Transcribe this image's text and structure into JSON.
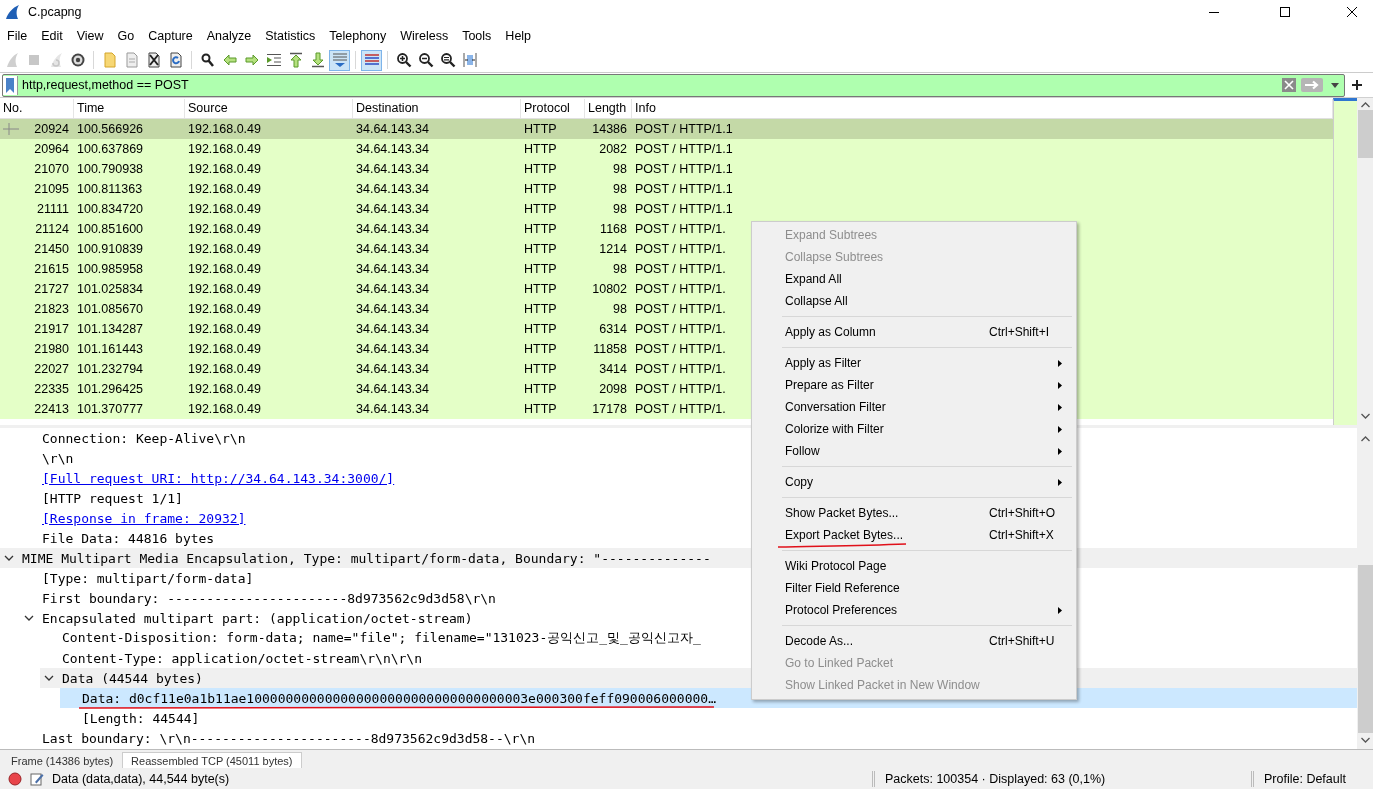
{
  "window": {
    "title": "C.pcapng"
  },
  "menu_bar": [
    "File",
    "Edit",
    "View",
    "Go",
    "Capture",
    "Analyze",
    "Statistics",
    "Telephony",
    "Wireless",
    "Tools",
    "Help"
  ],
  "toolbar": [
    {
      "kind": "shark",
      "disabled": true,
      "pressed": false
    },
    {
      "kind": "stop",
      "disabled": true,
      "pressed": false
    },
    {
      "kind": "restart",
      "disabled": true,
      "pressed": false
    },
    {
      "kind": "options",
      "disabled": false,
      "pressed": false
    },
    {
      "kind": "separator"
    },
    {
      "kind": "open",
      "disabled": false,
      "pressed": false
    },
    {
      "kind": "save",
      "disabled": false,
      "pressed": false
    },
    {
      "kind": "close",
      "disabled": false,
      "pressed": false
    },
    {
      "kind": "reload",
      "disabled": false,
      "pressed": false
    },
    {
      "kind": "separator"
    },
    {
      "kind": "find",
      "disabled": false,
      "pressed": false
    },
    {
      "kind": "back",
      "disabled": false,
      "pressed": false
    },
    {
      "kind": "forward",
      "disabled": false,
      "pressed": false
    },
    {
      "kind": "goto",
      "disabled": false,
      "pressed": false
    },
    {
      "kind": "first",
      "disabled": false,
      "pressed": false
    },
    {
      "kind": "last",
      "disabled": false,
      "pressed": false
    },
    {
      "kind": "autoscroll",
      "disabled": false,
      "pressed": true
    },
    {
      "kind": "separator"
    },
    {
      "kind": "colorize",
      "disabled": false,
      "pressed": true
    },
    {
      "kind": "separator"
    },
    {
      "kind": "zoomin",
      "disabled": false,
      "pressed": false
    },
    {
      "kind": "zoomout",
      "disabled": false,
      "pressed": false
    },
    {
      "kind": "zoomreset",
      "disabled": false,
      "pressed": false
    },
    {
      "kind": "resize",
      "disabled": false,
      "pressed": false
    }
  ],
  "filter": {
    "value": "http,request,method == POST",
    "valid": true
  },
  "packet_list": {
    "columns": [
      "No.",
      "Time",
      "Source",
      "Destination",
      "Protocol",
      "Length",
      "Info"
    ],
    "rows": [
      {
        "cells": [
          "20924",
          "100.566926",
          "192.168.0.49",
          "34.64.143.34",
          "HTTP",
          "14386",
          "POST / HTTP/1.1"
        ],
        "selected": true,
        "related": true
      },
      {
        "cells": [
          "20964",
          "100.637869",
          "192.168.0.49",
          "34.64.143.34",
          "HTTP",
          "2082",
          "POST / HTTP/1.1"
        ],
        "selected": false,
        "related": false
      },
      {
        "cells": [
          "21070",
          "100.790938",
          "192.168.0.49",
          "34.64.143.34",
          "HTTP",
          "98",
          "POST / HTTP/1.1"
        ],
        "selected": false,
        "related": false
      },
      {
        "cells": [
          "21095",
          "100.811363",
          "192.168.0.49",
          "34.64.143.34",
          "HTTP",
          "98",
          "POST / HTTP/1.1"
        ],
        "selected": false,
        "related": false
      },
      {
        "cells": [
          "21111",
          "100.834720",
          "192.168.0.49",
          "34.64.143.34",
          "HTTP",
          "98",
          "POST / HTTP/1.1"
        ],
        "selected": false,
        "related": false
      },
      {
        "cells": [
          "21124",
          "100.851600",
          "192.168.0.49",
          "34.64.143.34",
          "HTTP",
          "1168",
          "POST / HTTP/1."
        ],
        "selected": false,
        "related": false
      },
      {
        "cells": [
          "21450",
          "100.910839",
          "192.168.0.49",
          "34.64.143.34",
          "HTTP",
          "1214",
          "POST / HTTP/1."
        ],
        "selected": false,
        "related": false
      },
      {
        "cells": [
          "21615",
          "100.985958",
          "192.168.0.49",
          "34.64.143.34",
          "HTTP",
          "98",
          "POST / HTTP/1."
        ],
        "selected": false,
        "related": false
      },
      {
        "cells": [
          "21727",
          "101.025834",
          "192.168.0.49",
          "34.64.143.34",
          "HTTP",
          "10802",
          "POST / HTTP/1."
        ],
        "selected": false,
        "related": false
      },
      {
        "cells": [
          "21823",
          "101.085670",
          "192.168.0.49",
          "34.64.143.34",
          "HTTP",
          "98",
          "POST / HTTP/1."
        ],
        "selected": false,
        "related": false
      },
      {
        "cells": [
          "21917",
          "101.134287",
          "192.168.0.49",
          "34.64.143.34",
          "HTTP",
          "6314",
          "POST / HTTP/1."
        ],
        "selected": false,
        "related": false
      },
      {
        "cells": [
          "21980",
          "101.161443",
          "192.168.0.49",
          "34.64.143.34",
          "HTTP",
          "11858",
          "POST / HTTP/1."
        ],
        "selected": false,
        "related": false
      },
      {
        "cells": [
          "22027",
          "101.232794",
          "192.168.0.49",
          "34.64.143.34",
          "HTTP",
          "3414",
          "POST / HTTP/1."
        ],
        "selected": false,
        "related": false
      },
      {
        "cells": [
          "22335",
          "101.296425",
          "192.168.0.49",
          "34.64.143.34",
          "HTTP",
          "2098",
          "POST / HTTP/1."
        ],
        "selected": false,
        "related": false
      },
      {
        "cells": [
          "22413",
          "101.370777",
          "192.168.0.49",
          "34.64.143.34",
          "HTTP",
          "17178",
          "POST / HTTP/1."
        ],
        "selected": false,
        "related": false
      }
    ]
  },
  "packet_details": [
    {
      "kind": "continued",
      "children": [
        {
          "kind": "field",
          "text": "Connection: Keep-Alive\\r\\n",
          "selected": false,
          "shaded": false,
          "underlined": false
        },
        {
          "kind": "field",
          "text": "\\r\\n",
          "selected": false,
          "shaded": false,
          "underlined": false
        },
        {
          "kind": "link",
          "text": "[Full request URI: http://34.64.143.34:3000/]",
          "selected": false,
          "shaded": false,
          "underlined": false
        },
        {
          "kind": "field",
          "text": "[HTTP request 1/1]",
          "selected": false,
          "shaded": false,
          "underlined": false
        },
        {
          "kind": "link",
          "text": "[Response in frame: 20932]",
          "selected": false,
          "shaded": false,
          "underlined": false
        },
        {
          "kind": "field",
          "text": "File Data: 44816 bytes",
          "selected": false,
          "shaded": false,
          "underlined": false
        }
      ]
    },
    {
      "kind": "field",
      "text": "MIME Multipart Media Encapsulation, Type: multipart/form-data, Boundary: \"--------------",
      "expanded": true,
      "selected": false,
      "shaded": true,
      "underlined": false,
      "children": [
        {
          "kind": "field",
          "text": "[Type: multipart/form-data]",
          "selected": false,
          "shaded": false,
          "underlined": false
        },
        {
          "kind": "field",
          "text": "First boundary: -----------------------8d973562c9d3d58\\r\\n",
          "selected": false,
          "shaded": false,
          "underlined": false
        },
        {
          "kind": "field",
          "text": "Encapsulated multipart part:  (application/octet-stream)",
          "expanded": true,
          "selected": false,
          "shaded": false,
          "underlined": false,
          "children": [
            {
              "kind": "field",
              "text": "Content-Disposition: form-data; name=\"file\"; filename=\"131023-공익신고_및_공익신고자_",
              "selected": false,
              "shaded": false,
              "underlined": false
            },
            {
              "kind": "field",
              "text": "Content-Type: application/octet-stream\\r\\n\\r\\n",
              "selected": false,
              "shaded": false,
              "underlined": false
            },
            {
              "kind": "field",
              "text": "Data (44544 bytes)",
              "expanded": true,
              "selected": false,
              "shaded": true,
              "underlined": false,
              "children": [
                {
                  "kind": "field",
                  "text": "Data: d0cf11e0a1b11ae100000000000000000000000000000000003e000300feff090006000000…",
                  "selected": true,
                  "shaded": false,
                  "underlined": true
                },
                {
                  "kind": "field",
                  "text": "[Length: 44544]",
                  "selected": false,
                  "shaded": false,
                  "underlined": false
                }
              ]
            }
          ]
        },
        {
          "kind": "field",
          "text": "Last boundary: \\r\\n-----------------------8d973562c9d3d58--\\r\\n",
          "selected": false,
          "shaded": false,
          "underlined": false
        }
      ]
    }
  ],
  "byte_tabs": [
    {
      "label": "Frame (14386 bytes)",
      "selected": false
    },
    {
      "label": "Reassembled TCP (45011 bytes)",
      "selected": true
    }
  ],
  "status_bar": {
    "field_info": "Data (data,data), 44,544 byte(s)",
    "packets": "Packets: 100354 · Displayed: 63 (0,1%)",
    "profile": "Profile: Default"
  },
  "context_menu": [
    {
      "kind": "item",
      "text": "Expand Subtrees",
      "submenu": false,
      "disabled": true,
      "underlined": false
    },
    {
      "kind": "item",
      "text": "Collapse Subtrees",
      "submenu": false,
      "disabled": true,
      "underlined": false
    },
    {
      "kind": "item",
      "text": "Expand All",
      "submenu": false,
      "disabled": false,
      "underlined": false
    },
    {
      "kind": "item",
      "text": "Collapse All",
      "submenu": false,
      "disabled": false,
      "underlined": false
    },
    {
      "kind": "separator"
    },
    {
      "kind": "item",
      "text": "Apply as Column",
      "shortcut": "Ctrl+Shift+I",
      "submenu": false,
      "disabled": false,
      "underlined": false
    },
    {
      "kind": "separator"
    },
    {
      "kind": "item",
      "text": "Apply as Filter",
      "submenu": true,
      "disabled": false,
      "underlined": false
    },
    {
      "kind": "item",
      "text": "Prepare as Filter",
      "submenu": true,
      "disabled": false,
      "underlined": false
    },
    {
      "kind": "item",
      "text": "Conversation Filter",
      "submenu": true,
      "disabled": false,
      "underlined": false
    },
    {
      "kind": "item",
      "text": "Colorize with Filter",
      "submenu": true,
      "disabled": false,
      "underlined": false
    },
    {
      "kind": "item",
      "text": "Follow",
      "submenu": true,
      "disabled": false,
      "underlined": false
    },
    {
      "kind": "separator"
    },
    {
      "kind": "item",
      "text": "Copy",
      "submenu": true,
      "disabled": false,
      "underlined": false
    },
    {
      "kind": "separator"
    },
    {
      "kind": "item",
      "text": "Show Packet Bytes...",
      "shortcut": "Ctrl+Shift+O",
      "submenu": false,
      "disabled": false,
      "underlined": false
    },
    {
      "kind": "item",
      "text": "Export Packet Bytes...",
      "shortcut": "Ctrl+Shift+X",
      "submenu": false,
      "disabled": false,
      "underlined": true
    },
    {
      "kind": "separator"
    },
    {
      "kind": "item",
      "text": "Wiki Protocol Page",
      "submenu": false,
      "disabled": false,
      "underlined": false
    },
    {
      "kind": "item",
      "text": "Filter Field Reference",
      "submenu": false,
      "disabled": false,
      "underlined": false
    },
    {
      "kind": "item",
      "text": "Protocol Preferences",
      "submenu": true,
      "disabled": false,
      "underlined": false
    },
    {
      "kind": "separator"
    },
    {
      "kind": "item",
      "text": "Decode As...",
      "shortcut": "Ctrl+Shift+U",
      "submenu": false,
      "disabled": false,
      "underlined": false
    },
    {
      "kind": "item",
      "text": "Go to Linked Packet",
      "submenu": false,
      "disabled": true,
      "underlined": false
    },
    {
      "kind": "item",
      "text": "Show Linked Packet in New Window",
      "submenu": false,
      "disabled": true,
      "underlined": false
    }
  ]
}
